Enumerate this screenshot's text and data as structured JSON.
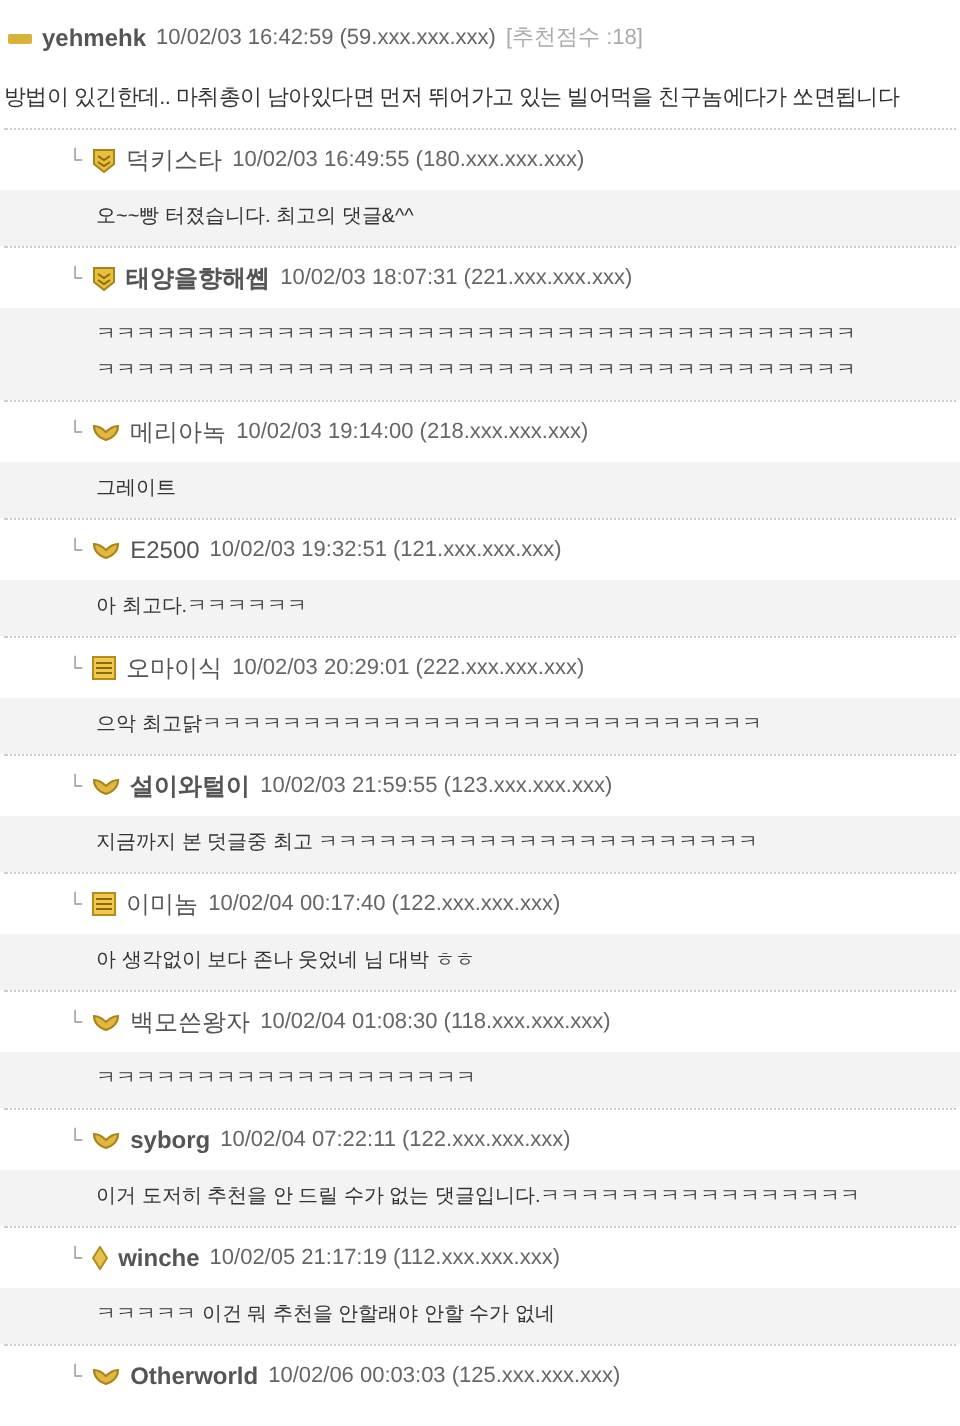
{
  "comment": {
    "kind": "dash",
    "nick": "yehmehk",
    "bold": true,
    "date": "10/02/03 16:42:59",
    "ip": "(59.xxx.xxx.xxx)",
    "score": "[추천점수 :18]",
    "body": "방법이 있긴한데.. 마취총이 남아있다면 먼저 뛰어가고 있는 빌어먹을 친구놈에다가 쏘면됩니다"
  },
  "replies": [
    {
      "arrow": "└",
      "kind": "shield",
      "nick": "덕키스타",
      "bold": false,
      "date": "10/02/03 16:49:55",
      "ip": "(180.xxx.xxx.xxx)",
      "lines": [
        "오~~빵 터졌습니다. 최고의 댓글&^^"
      ]
    },
    {
      "arrow": "└",
      "kind": "shield",
      "nick": "태양을향해쏍",
      "bold": true,
      "date": "10/02/03 18:07:31",
      "ip": "(221.xxx.xxx.xxx)",
      "lines": [
        "ㅋㅋㅋㅋㅋㅋㅋㅋㅋㅋㅋㅋㅋㅋㅋㅋㅋㅋㅋㅋㅋㅋㅋㅋㅋㅋㅋㅋㅋㅋㅋㅋㅋㅋㅋㅋㅋㅋ",
        "ㅋㅋㅋㅋㅋㅋㅋㅋㅋㅋㅋㅋㅋㅋㅋㅋㅋㅋㅋㅋㅋㅋㅋㅋㅋㅋㅋㅋㅋㅋㅋㅋㅋㅋㅋㅋㅋㅋ"
      ]
    },
    {
      "arrow": "└",
      "kind": "wings",
      "nick": "메리아녹",
      "bold": false,
      "date": "10/02/03 19:14:00",
      "ip": "(218.xxx.xxx.xxx)",
      "lines": [
        "그레이트"
      ]
    },
    {
      "arrow": "└",
      "kind": "wings",
      "nick": "E2500",
      "bold": false,
      "date": "10/02/03 19:32:51",
      "ip": "(121.xxx.xxx.xxx)",
      "lines": [
        "아 최고다.ㅋㅋㅋㅋㅋㅋ"
      ]
    },
    {
      "arrow": "└",
      "kind": "bars",
      "nick": "오마이식",
      "bold": false,
      "date": "10/02/03 20:29:01",
      "ip": "(222.xxx.xxx.xxx)",
      "lines": [
        "으악 최고닭ㅋㅋㅋㅋㅋㅋㅋㅋㅋㅋㅋㅋㅋㅋㅋㅋㅋㅋㅋㅋㅋㅋㅋㅋㅋㅋㅋㅋ"
      ]
    },
    {
      "arrow": "└",
      "kind": "wings",
      "nick": "설이와털이",
      "bold": true,
      "date": "10/02/03 21:59:55",
      "ip": "(123.xxx.xxx.xxx)",
      "lines": [
        "지금까지 본 덧글중 최고 ㅋㅋㅋㅋㅋㅋㅋㅋㅋㅋㅋㅋㅋㅋㅋㅋㅋㅋㅋㅋㅋㅋ"
      ]
    },
    {
      "arrow": "└",
      "kind": "bars",
      "nick": "이미놈",
      "bold": false,
      "date": "10/02/04 00:17:40",
      "ip": "(122.xxx.xxx.xxx)",
      "lines": [
        "아 생각없이 보다 존나 웃었네 님 대박 ㅎㅎ"
      ]
    },
    {
      "arrow": "└",
      "kind": "wings",
      "nick": "백모쓴왕자",
      "bold": false,
      "date": "10/02/04 01:08:30",
      "ip": "(118.xxx.xxx.xxx)",
      "lines": [
        "ㅋㅋㅋㅋㅋㅋㅋㅋㅋㅋㅋㅋㅋㅋㅋㅋㅋㅋㅋ"
      ]
    },
    {
      "arrow": "└",
      "kind": "wings",
      "nick": "syborg",
      "bold": true,
      "date": "10/02/04 07:22:11",
      "ip": "(122.xxx.xxx.xxx)",
      "lines": [
        "이거 도저히 추천을 안 드릴 수가 없는 댓글입니다.ㅋㅋㅋㅋㅋㅋㅋㅋㅋㅋㅋㅋㅋㅋㅋㅋ"
      ]
    },
    {
      "arrow": "└",
      "kind": "diamond",
      "nick": "winche",
      "bold": true,
      "date": "10/02/05 21:17:19",
      "ip": "(112.xxx.xxx.xxx)",
      "lines": [
        "ㅋㅋㅋㅋㅋ 이건 뭐 추천을 안할래야 안할 수가 없네"
      ]
    },
    {
      "arrow": "└",
      "kind": "wings",
      "nick": "Otherworld",
      "bold": true,
      "date": "10/02/06 00:03:03",
      "ip": "(125.xxx.xxx.xxx)"
    }
  ]
}
